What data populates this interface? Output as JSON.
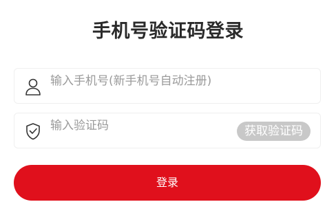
{
  "page": {
    "title": "手机号验证码登录"
  },
  "phone_field": {
    "icon": "user-icon",
    "placeholder": "输入手机号(新手机号自动注册)",
    "value": ""
  },
  "code_field": {
    "icon": "shield-check-icon",
    "placeholder": "输入验证码",
    "value": "",
    "get_code_label": "获取验证码"
  },
  "login_button": {
    "label": "登录"
  },
  "colors": {
    "primary": "#e0101c",
    "disabled_button": "#c8c8c8",
    "title_text": "#2a2a2a",
    "placeholder_text": "#9a9a9a",
    "field_border": "#efefef"
  }
}
